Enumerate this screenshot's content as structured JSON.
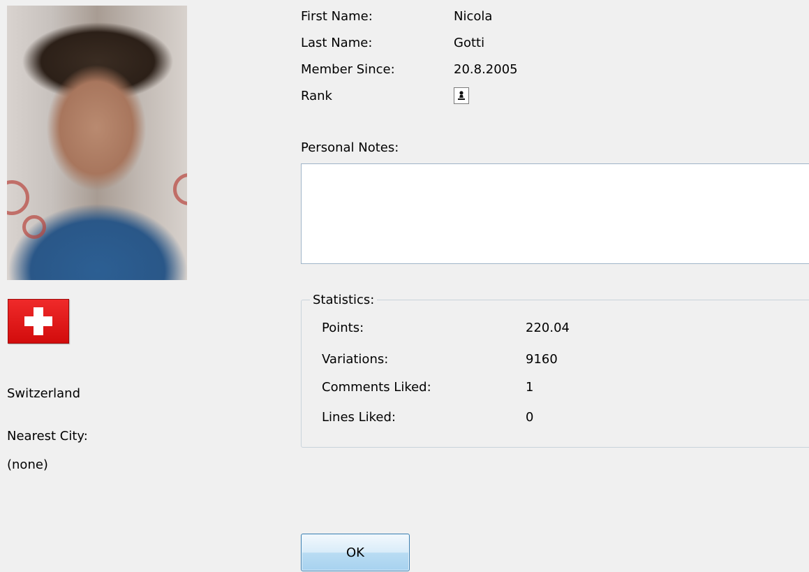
{
  "profile": {
    "first_name_label": "First Name:",
    "first_name_value": "Nicola",
    "last_name_label": "Last Name:",
    "last_name_value": "Gotti",
    "member_since_label": "Member Since:",
    "member_since_value": "20.8.2005",
    "rank_label": "Rank",
    "rank_icon": "chess-pawn-icon"
  },
  "left": {
    "country": "Switzerland",
    "nearest_city_label": "Nearest City:",
    "nearest_city_value": "(none)",
    "flag_icon": "swiss-flag-icon"
  },
  "notes": {
    "label": "Personal Notes:",
    "value": ""
  },
  "statistics": {
    "title": "Statistics:",
    "rows": [
      {
        "label": "Points:",
        "value": "220.04"
      },
      {
        "label": "Variations:",
        "value": "9160"
      },
      {
        "label": "Comments Liked:",
        "value": "1"
      },
      {
        "label": "Lines Liked:",
        "value": "0"
      }
    ]
  },
  "buttons": {
    "ok_label": "OK"
  },
  "colors": {
    "background": "#f0f0f0",
    "flag_red": "#e31b1b",
    "button_border": "#3c7fb1"
  }
}
